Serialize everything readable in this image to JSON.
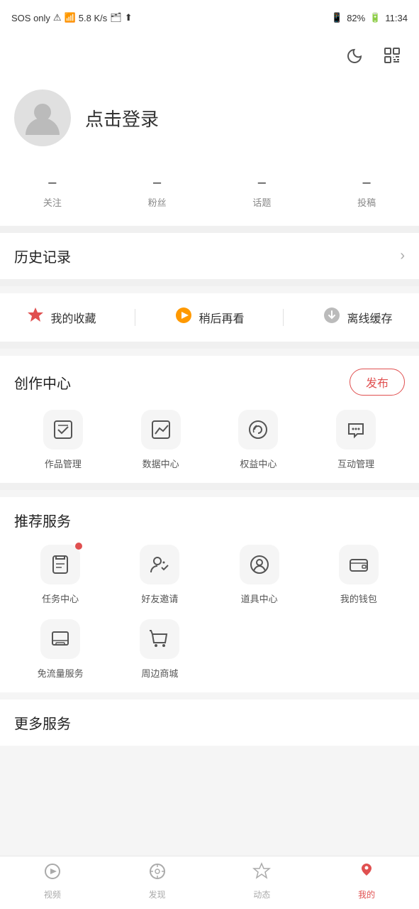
{
  "statusBar": {
    "sosText": "SOS only",
    "signalText": "📶",
    "networkSpeed": "5.8 K/s",
    "battery": "82%",
    "time": "11:34"
  },
  "topActions": {
    "moonLabel": "moon",
    "scanLabel": "scan"
  },
  "profile": {
    "loginText": "点击登录",
    "avatarAlt": "avatar"
  },
  "stats": [
    {
      "value": "–",
      "label": "关注"
    },
    {
      "value": "–",
      "label": "粉丝"
    },
    {
      "value": "–",
      "label": "话题"
    },
    {
      "value": "–",
      "label": "投稿"
    }
  ],
  "history": {
    "title": "历史记录"
  },
  "quickLinks": [
    {
      "label": "我的收藏",
      "iconType": "star",
      "color": "red"
    },
    {
      "label": "稍后再看",
      "iconType": "play",
      "color": "orange"
    },
    {
      "label": "离线缓存",
      "iconType": "download",
      "color": "gray"
    }
  ],
  "creation": {
    "title": "创作中心",
    "publishBtn": "发布",
    "items": [
      {
        "label": "作品管理",
        "icon": "📋"
      },
      {
        "label": "数据中心",
        "icon": "📊"
      },
      {
        "label": "权益中心",
        "icon": "🎧"
      },
      {
        "label": "互动管理",
        "icon": "💬"
      }
    ]
  },
  "services": {
    "title": "推荐服务",
    "items": [
      {
        "label": "任务中心",
        "icon": "🎒",
        "badge": true
      },
      {
        "label": "好友邀请",
        "icon": "😊",
        "badge": false
      },
      {
        "label": "道具中心",
        "icon": "😃",
        "badge": false
      },
      {
        "label": "我的钱包",
        "icon": "👛",
        "badge": false
      },
      {
        "label": "免流量服务",
        "icon": "🖥",
        "badge": false
      },
      {
        "label": "周边商城",
        "icon": "🏪",
        "badge": false
      }
    ]
  },
  "moreServices": {
    "title": "更多服务"
  },
  "bottomNav": [
    {
      "label": "视频",
      "icon": "video",
      "active": false
    },
    {
      "label": "发现",
      "icon": "discover",
      "active": false
    },
    {
      "label": "动态",
      "icon": "star",
      "active": false
    },
    {
      "label": "我的",
      "icon": "mine",
      "active": true
    }
  ]
}
